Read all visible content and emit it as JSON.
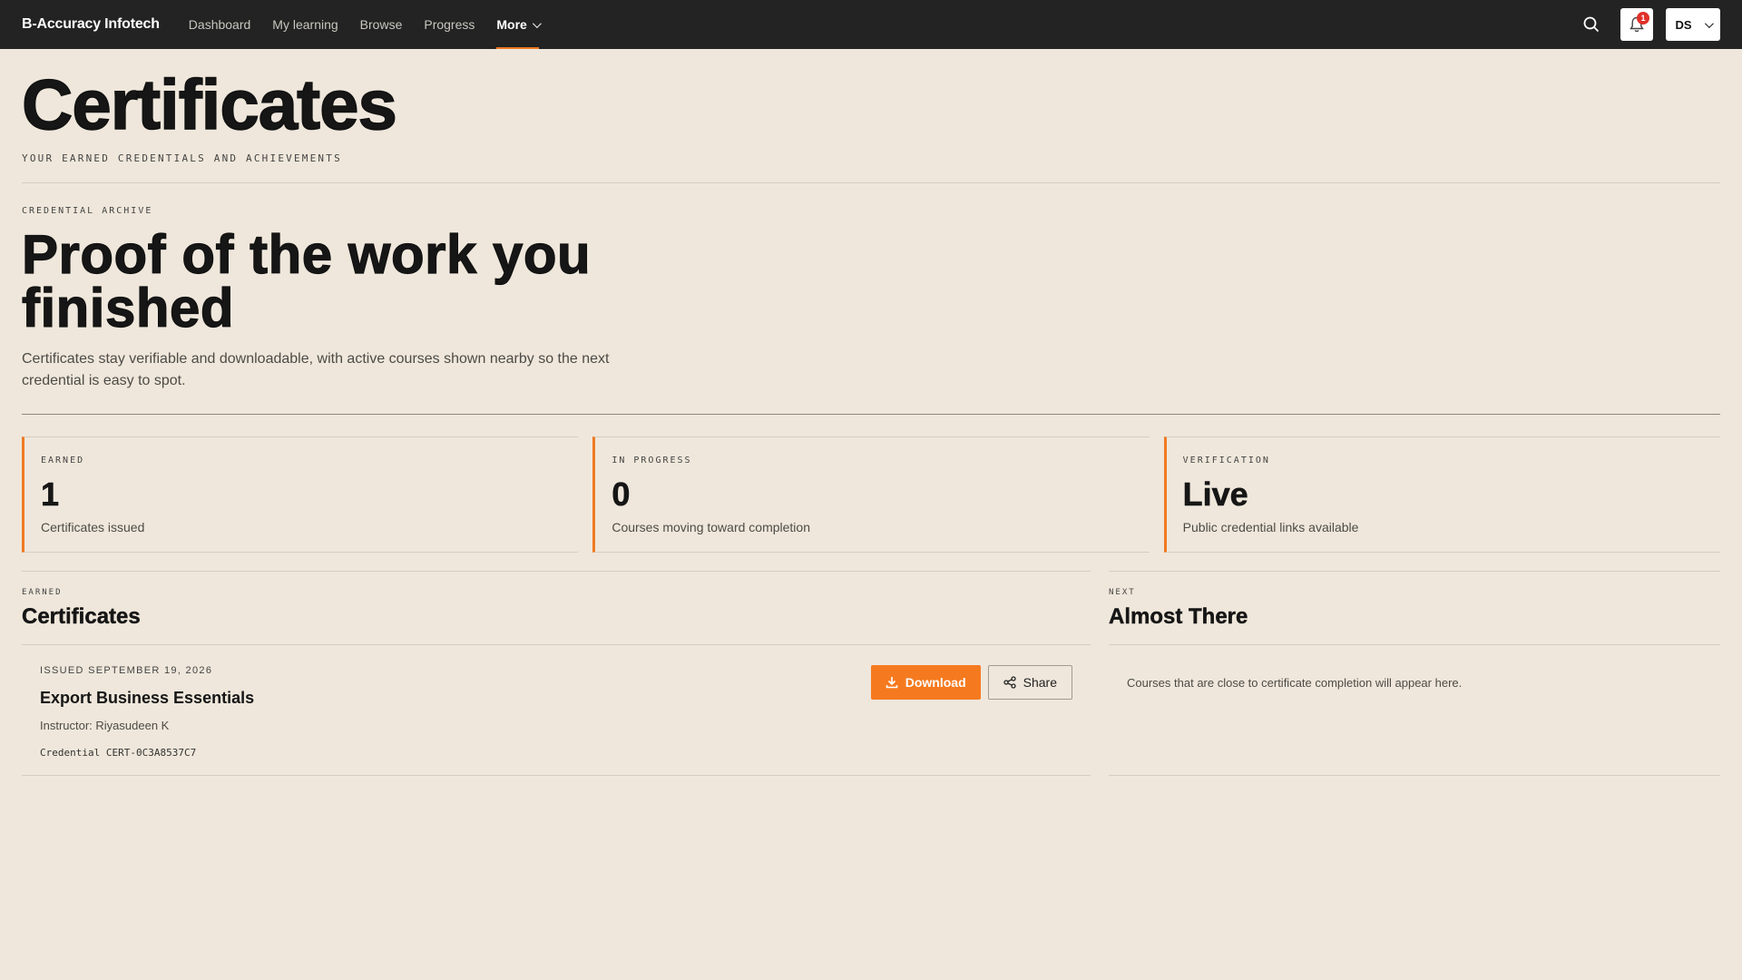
{
  "nav": {
    "brand": "B-Accuracy Infotech",
    "links": [
      "Dashboard",
      "My learning",
      "Browse",
      "Progress"
    ],
    "more_label": "More",
    "notification_count": "1",
    "avatar_initials": "DS",
    "accent_color": "#f07a22"
  },
  "page": {
    "title": "Certificates",
    "subtitle": "YOUR EARNED CREDENTIALS AND ACHIEVEMENTS"
  },
  "hero": {
    "eyebrow": "CREDENTIAL ARCHIVE",
    "heading": "Proof of the work you finished",
    "description": "Certificates stay verifiable and downloadable, with active courses shown nearby so the next credential is easy to spot."
  },
  "stats": [
    {
      "label": "EARNED",
      "value": "1",
      "desc": "Certificates issued"
    },
    {
      "label": "IN PROGRESS",
      "value": "0",
      "desc": "Courses moving toward completion"
    },
    {
      "label": "VERIFICATION",
      "value": "Live",
      "desc": "Public credential links available"
    }
  ],
  "earned": {
    "eyebrow": "EARNED",
    "title": "Certificates",
    "certificate": {
      "issued": "ISSUED SEPTEMBER 19, 2026",
      "name": "Export Business Essentials",
      "instructor": "Instructor: Riyasudeen K",
      "credential": "Credential CERT-0C3A8537C7",
      "download_label": "Download",
      "share_label": "Share"
    }
  },
  "next": {
    "eyebrow": "NEXT",
    "title": "Almost There",
    "empty_text": "Courses that are close to certificate completion will appear here."
  }
}
